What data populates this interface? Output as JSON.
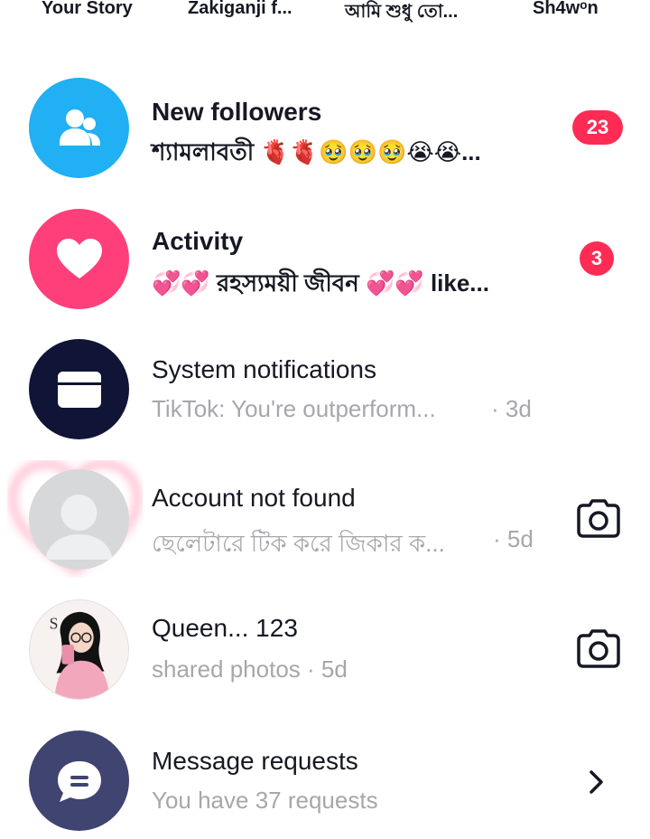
{
  "stories": [
    {
      "name": "Your Story"
    },
    {
      "name": "Zakiganji f..."
    },
    {
      "name": "আমি শুধু তো..."
    },
    {
      "name": "Sh4wᵒn"
    }
  ],
  "rows": [
    {
      "title": "New followers",
      "subtitle": "শ্যামলাবতী 🫀🫀🥹🥹🥹😭😭...",
      "badge": "23",
      "icon": "users-icon",
      "color": "#20b0f3"
    },
    {
      "title": "Activity",
      "subtitle": "💞💞 রহস্যময়ী জীবন 💞💞 like...",
      "badge": "3",
      "icon": "heart-icon",
      "color": "#fe3f7a"
    },
    {
      "title": "System notifications",
      "subtitle": "TikTok: You're outperform...",
      "time": "· 3d",
      "icon": "inbox-icon",
      "color": "#101436"
    },
    {
      "title": "Account not found",
      "subtitle": "ছেলেটারে টিক করে জিকার ক...",
      "time": "· 5d",
      "icon": "camera-icon"
    },
    {
      "title": "Queen... 123",
      "subtitle": "shared photos · 5d",
      "icon": "camera-icon"
    },
    {
      "title": "Message requests",
      "subtitle": "You have 37 requests",
      "icon": "chevron-right-icon",
      "color": "#3f4470"
    }
  ]
}
